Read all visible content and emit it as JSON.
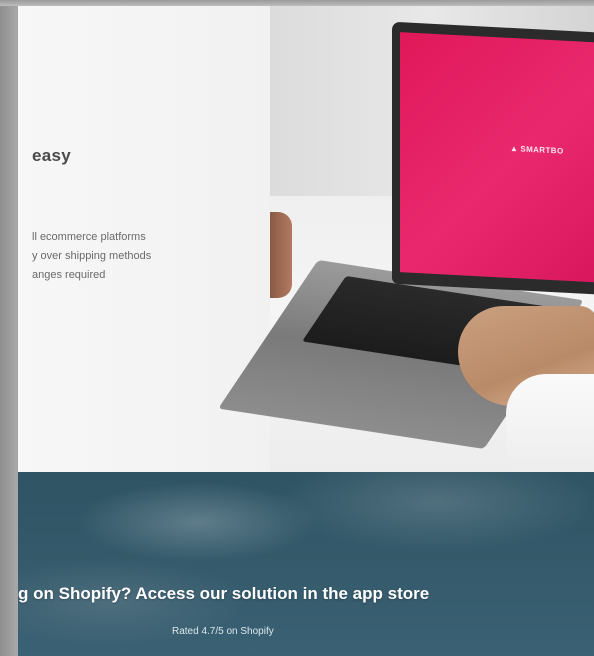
{
  "hero": {
    "heading": "easy",
    "features": [
      "ll ecommerce platforms",
      "y over shipping methods",
      "anges required"
    ],
    "laptop_screen_logo": "SMARTBO"
  },
  "banner": {
    "heading": "g on Shopify? Access our solution in the app store",
    "rating": "Rated 4.7/5 on Shopify"
  },
  "colors": {
    "screen_accent": "#e0185a",
    "banner_bg": "#345a6b",
    "panel_bg": "#f4f4f4"
  }
}
